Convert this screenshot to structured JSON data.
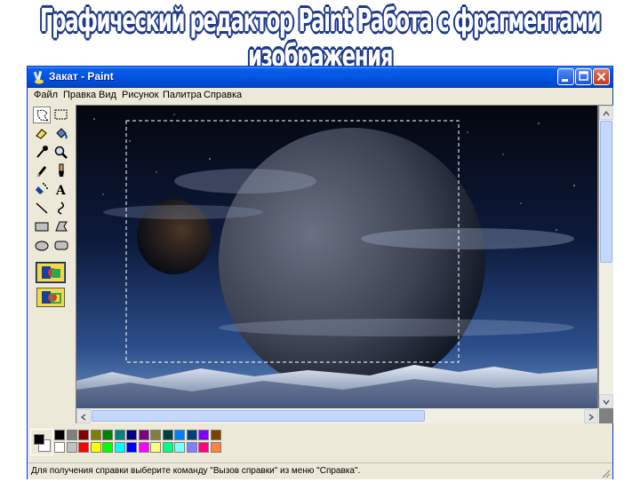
{
  "slide": {
    "title": "Графический редактор Paint Работа с фрагментами изображения"
  },
  "window": {
    "title": "Закат - Paint",
    "icon": "paint-brush-icon"
  },
  "menu": {
    "items": [
      "Файл",
      "Правка",
      "Вид",
      "Рисунок",
      "Палитра",
      "Справка"
    ]
  },
  "toolbox": {
    "tools": [
      {
        "name": "free-select-icon",
        "active": true
      },
      {
        "name": "rect-select-icon",
        "active": false
      },
      {
        "name": "eraser-icon",
        "active": false
      },
      {
        "name": "fill-icon",
        "active": false
      },
      {
        "name": "color-picker-icon",
        "active": false
      },
      {
        "name": "magnifier-icon",
        "active": false
      },
      {
        "name": "pencil-icon",
        "active": false
      },
      {
        "name": "brush-icon",
        "active": false
      },
      {
        "name": "airbrush-icon",
        "active": false
      },
      {
        "name": "text-icon",
        "active": false
      },
      {
        "name": "line-icon",
        "active": false
      },
      {
        "name": "curve-icon",
        "active": false
      },
      {
        "name": "rectangle-icon",
        "active": false
      },
      {
        "name": "polygon-icon",
        "active": false
      },
      {
        "name": "ellipse-icon",
        "active": false
      },
      {
        "name": "rounded-rect-icon",
        "active": false
      }
    ],
    "options": [
      {
        "name": "opaque-selection-icon",
        "selected": true
      },
      {
        "name": "transparent-selection-icon",
        "selected": false
      }
    ],
    "text_tool_glyph": "A"
  },
  "palette": {
    "foreground": "#000000",
    "background": "#ffffff",
    "top_row": [
      "#000000",
      "#808080",
      "#800000",
      "#808000",
      "#008000",
      "#008080",
      "#000080",
      "#800080",
      "#808040",
      "#004040",
      "#0080ff",
      "#004080",
      "#8000ff",
      "#804000"
    ],
    "bottom_row": [
      "#ffffff",
      "#c0c0c0",
      "#ff0000",
      "#ffff00",
      "#00ff00",
      "#00ffff",
      "#0000ff",
      "#ff00ff",
      "#ffff80",
      "#00ff80",
      "#80ffff",
      "#8080ff",
      "#ff0080",
      "#ff8040"
    ]
  },
  "status": {
    "text": "Для получения справки выберите команду \"Вызов справки\" из меню \"Справка\"."
  },
  "colors": {
    "title_outline": "#1d3a8a",
    "titlebar": "#0054e3",
    "window_bg": "#ece9d8"
  }
}
